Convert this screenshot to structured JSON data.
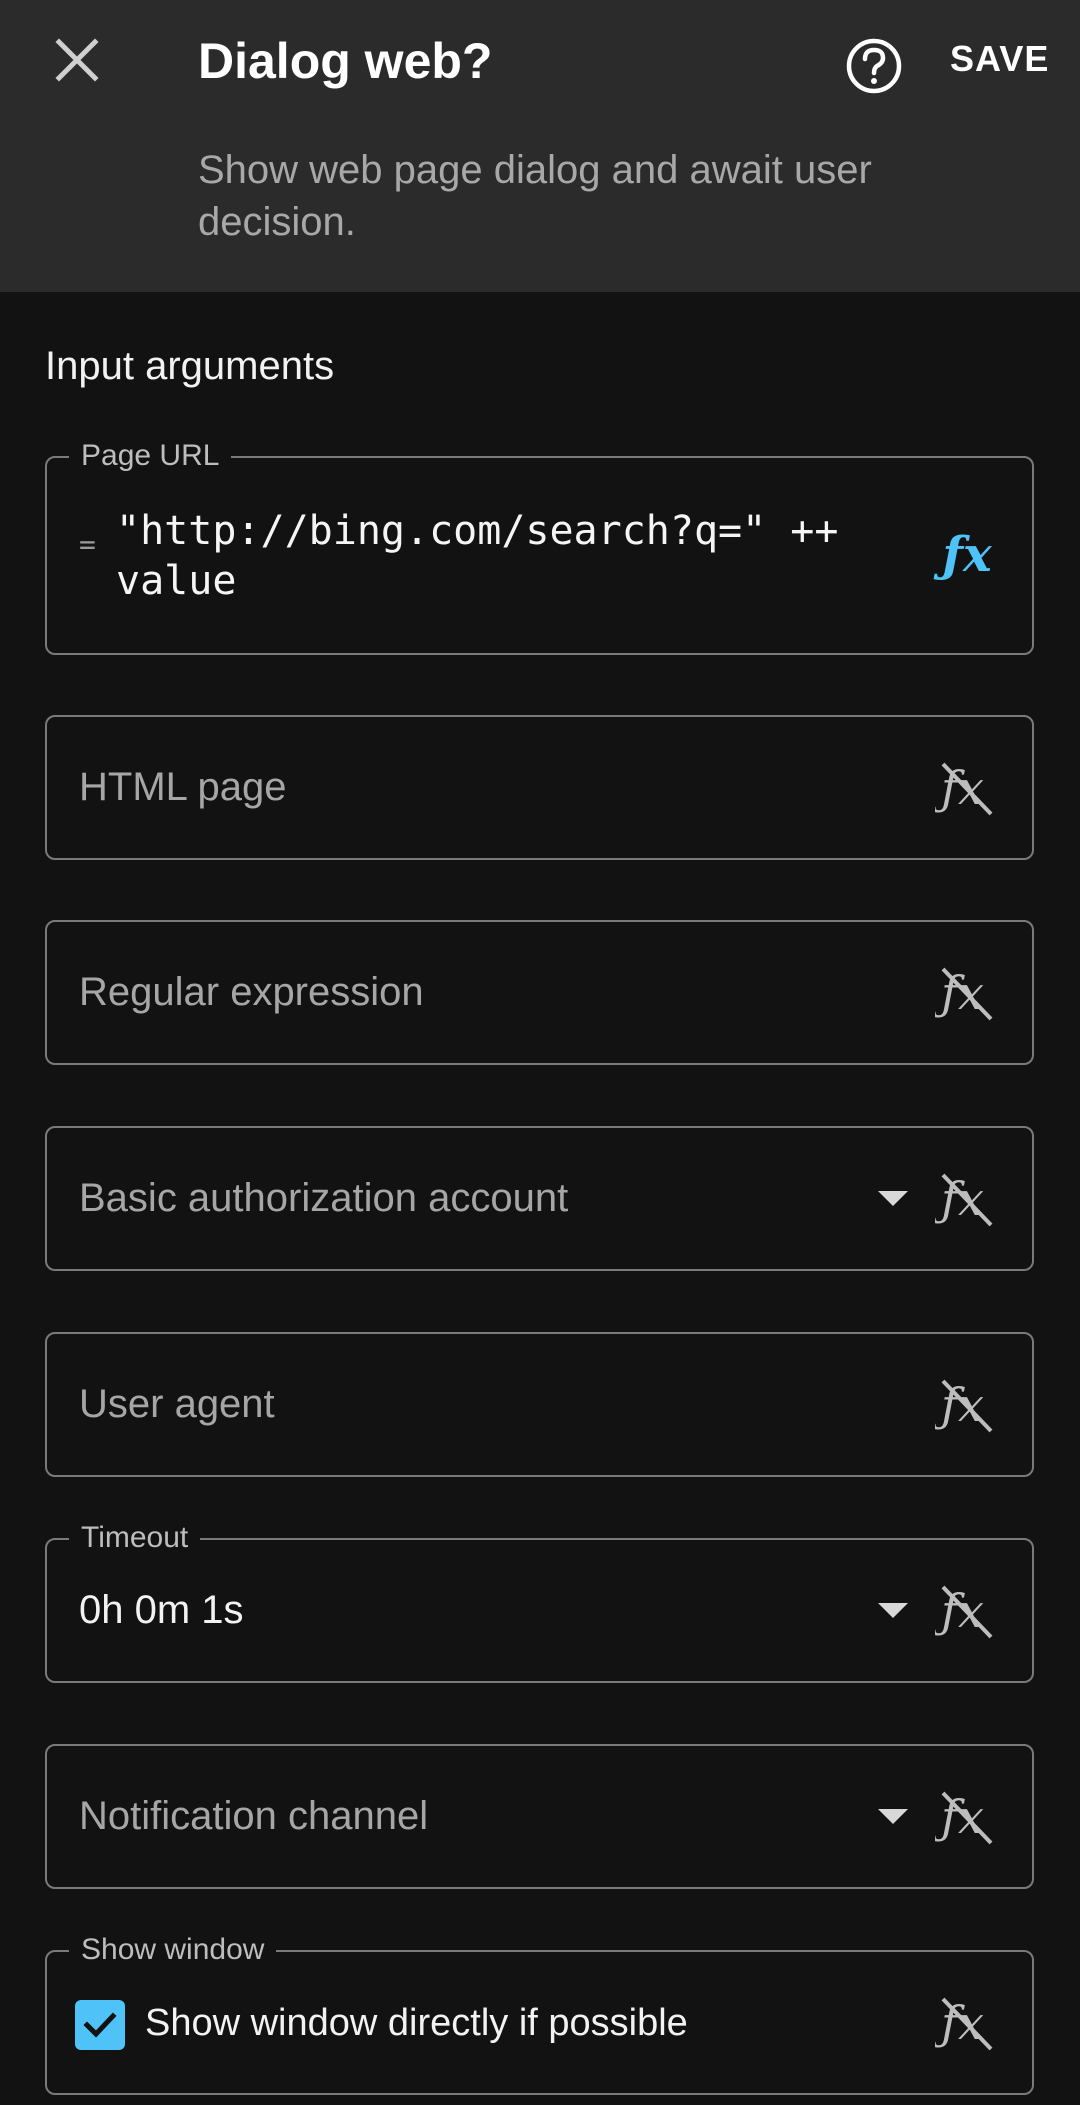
{
  "header": {
    "title": "Dialog web?",
    "subtitle": "Show web page dialog and await user decision.",
    "save_label": "SAVE"
  },
  "section": {
    "title": "Input arguments"
  },
  "colors": {
    "accent": "#4fc3f7",
    "header_bg": "#2b2b2b",
    "page_bg": "#121212"
  },
  "fields": {
    "page_url": {
      "label": "Page URL",
      "prefix": "=",
      "value": "\"http://bing.com/search?q=\" ++\nvalue",
      "fx_icon": "fx-active-icon"
    },
    "html_page": {
      "placeholder": "HTML page",
      "fx_icon": "fx-disabled-icon"
    },
    "regular_expression": {
      "placeholder": "Regular expression",
      "fx_icon": "fx-disabled-icon"
    },
    "basic_auth": {
      "placeholder": "Basic authorization account",
      "fx_icon": "fx-disabled-icon"
    },
    "user_agent": {
      "placeholder": "User agent",
      "fx_icon": "fx-disabled-icon"
    },
    "timeout": {
      "label": "Timeout",
      "value": "0h 0m 1s",
      "fx_icon": "fx-disabled-icon"
    },
    "notification_channel": {
      "placeholder": "Notification channel",
      "fx_icon": "fx-disabled-icon"
    },
    "show_window": {
      "label": "Show window",
      "checkbox_label": "Show window directly if possible",
      "checked": true,
      "fx_icon": "fx-disabled-icon"
    }
  }
}
